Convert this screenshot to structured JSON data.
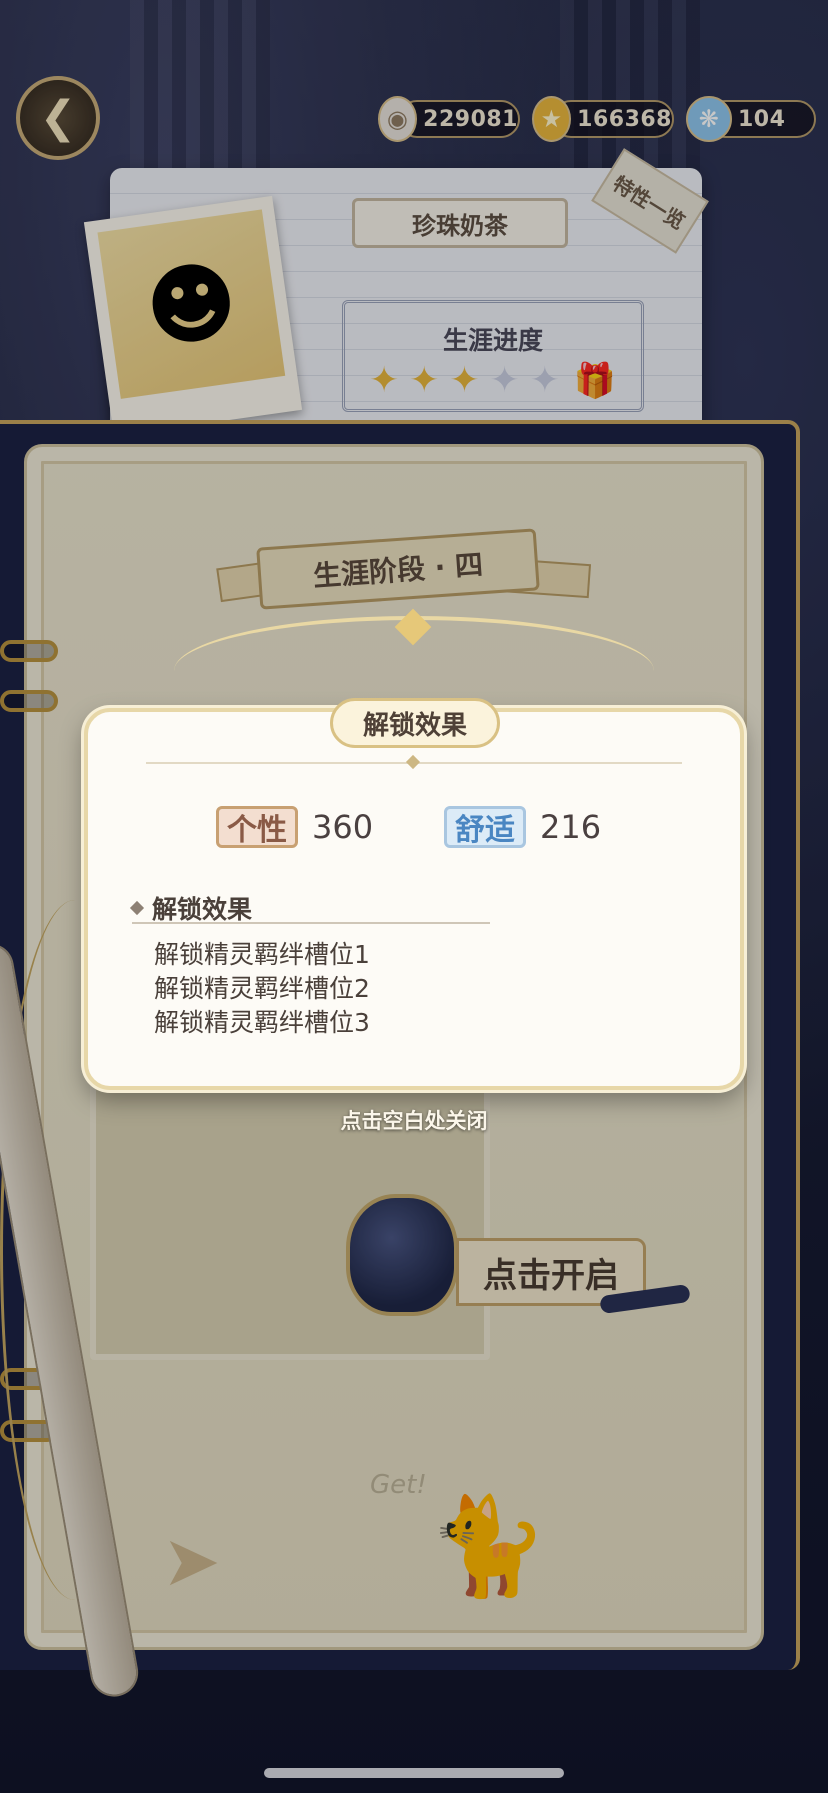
{
  "top_bar": {
    "back_icon": "winged-arrow-left-icon",
    "currencies": [
      {
        "icon": "pearl-shell-icon",
        "value": "229081"
      },
      {
        "icon": "gold-star-coin-icon",
        "value": "166368"
      },
      {
        "icon": "blue-crystal-icon",
        "value": "104"
      }
    ]
  },
  "profile": {
    "character_name": "珍珠奶茶",
    "traits_tab": "特性一览",
    "career_progress": {
      "title": "生涯进度",
      "filled_stars": 3,
      "total_stars": 5
    }
  },
  "book": {
    "stage_ribbon": "生涯阶段 · 四",
    "open_button": "点击开启",
    "doodle_text": "Get!"
  },
  "popup": {
    "title": "解锁效果",
    "stats": [
      {
        "label": "个性",
        "value": "360"
      },
      {
        "label": "舒适",
        "value": "216"
      }
    ],
    "section_title": "解锁效果",
    "effects": [
      "解锁精灵羁绊槽位1",
      "解锁精灵羁绊槽位2",
      "解锁精灵羁绊槽位3"
    ]
  },
  "close_hint": "点击空白处关闭",
  "colors": {
    "accent_gold": "#c7a45e",
    "personality": "#8a5a46",
    "comfort": "#4a86c2"
  }
}
